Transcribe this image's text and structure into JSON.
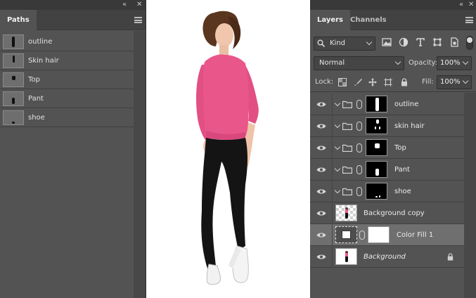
{
  "paths_panel": {
    "tab_label": "Paths",
    "collapse_glyph": "«",
    "close_glyph": "✕",
    "menu_icon": "hamburger-menu-icon",
    "items": [
      {
        "label": "outline"
      },
      {
        "label": "Skin hair"
      },
      {
        "label": "Top"
      },
      {
        "label": "Pant"
      },
      {
        "label": "shoe"
      }
    ]
  },
  "canvas": {
    "background": "#ffffff",
    "subject": "woman-in-pink-sweater-and-black-pants",
    "colors": {
      "sweater": "#e9568a",
      "pants": "#141414",
      "hair": "#5a3520",
      "skin": "#f0c7ad"
    }
  },
  "layers_panel": {
    "tabs": [
      {
        "label": "Layers",
        "active": true
      },
      {
        "label": "Channels",
        "active": false
      }
    ],
    "collapse_glyph": "«",
    "close_glyph": "✕",
    "filter": {
      "kind_label": "Kind"
    },
    "blend_mode": "Normal",
    "opacity_label": "Opacity:",
    "opacity_value": "100%",
    "lock_label": "Lock:",
    "fill_label": "Fill:",
    "fill_value": "100%",
    "layers": [
      {
        "name": "outline",
        "type": "group"
      },
      {
        "name": "skin hair",
        "type": "group"
      },
      {
        "name": "Top",
        "type": "group"
      },
      {
        "name": "Pant",
        "type": "group"
      },
      {
        "name": "shoe",
        "type": "group"
      },
      {
        "name": "Background copy",
        "type": "pixel"
      },
      {
        "name": "Color Fill 1",
        "type": "fill",
        "selected": true
      },
      {
        "name": "Background",
        "type": "background",
        "locked": true
      }
    ]
  }
}
